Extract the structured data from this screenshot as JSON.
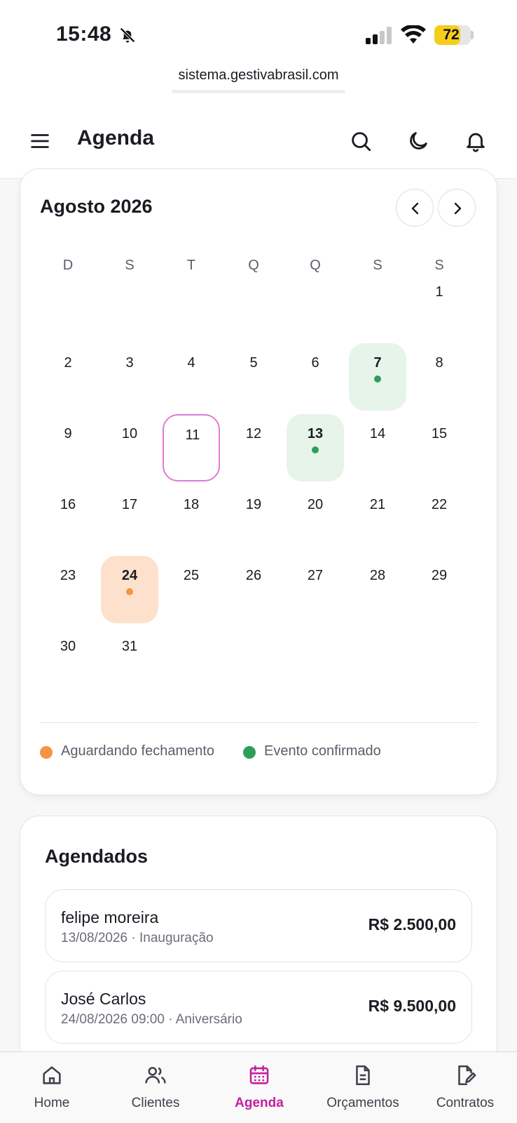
{
  "status_bar": {
    "time": "15:48",
    "battery": "72",
    "battery_level": 0.72
  },
  "browser": {
    "url": "sistema.gestivabrasil.com"
  },
  "header": {
    "title": "Agenda"
  },
  "calendar": {
    "month_label": "Agosto 2026",
    "weekdays": [
      "D",
      "S",
      "T",
      "Q",
      "Q",
      "S",
      "S"
    ],
    "days": [
      {
        "n": "1",
        "row": 0,
        "col": 6
      },
      {
        "n": "2",
        "row": 1,
        "col": 0
      },
      {
        "n": "3",
        "row": 1,
        "col": 1
      },
      {
        "n": "4",
        "row": 1,
        "col": 2
      },
      {
        "n": "5",
        "row": 1,
        "col": 3
      },
      {
        "n": "6",
        "row": 1,
        "col": 4
      },
      {
        "n": "7",
        "row": 1,
        "col": 5,
        "status": "confirmed"
      },
      {
        "n": "8",
        "row": 1,
        "col": 6
      },
      {
        "n": "9",
        "row": 2,
        "col": 0
      },
      {
        "n": "10",
        "row": 2,
        "col": 1
      },
      {
        "n": "11",
        "row": 2,
        "col": 2,
        "today": true
      },
      {
        "n": "12",
        "row": 2,
        "col": 3
      },
      {
        "n": "13",
        "row": 2,
        "col": 4,
        "status": "confirmed"
      },
      {
        "n": "14",
        "row": 2,
        "col": 5
      },
      {
        "n": "15",
        "row": 2,
        "col": 6
      },
      {
        "n": "16",
        "row": 3,
        "col": 0
      },
      {
        "n": "17",
        "row": 3,
        "col": 1
      },
      {
        "n": "18",
        "row": 3,
        "col": 2
      },
      {
        "n": "19",
        "row": 3,
        "col": 3
      },
      {
        "n": "20",
        "row": 3,
        "col": 4
      },
      {
        "n": "21",
        "row": 3,
        "col": 5
      },
      {
        "n": "22",
        "row": 3,
        "col": 6
      },
      {
        "n": "23",
        "row": 4,
        "col": 0
      },
      {
        "n": "24",
        "row": 4,
        "col": 1,
        "status": "pending"
      },
      {
        "n": "25",
        "row": 4,
        "col": 2
      },
      {
        "n": "26",
        "row": 4,
        "col": 3
      },
      {
        "n": "27",
        "row": 4,
        "col": 4
      },
      {
        "n": "28",
        "row": 4,
        "col": 5
      },
      {
        "n": "29",
        "row": 4,
        "col": 6
      },
      {
        "n": "30",
        "row": 5,
        "col": 0
      },
      {
        "n": "31",
        "row": 5,
        "col": 1
      }
    ],
    "legend": {
      "pending": "Aguardando fechamento",
      "confirmed": "Evento confirmado"
    }
  },
  "colors": {
    "accent": "#c51f9e",
    "today_border": "#e07ad6",
    "pending_dot": "#f59442",
    "pending_bg": "#fde1cc",
    "confirmed_dot": "#2f9e5a",
    "confirmed_bg": "#e7f4ea"
  },
  "agendados": {
    "title": "Agendados",
    "items": [
      {
        "name": "felipe moreira",
        "meta": "13/08/2026 · Inauguração",
        "value": "R$ 2.500,00"
      },
      {
        "name": "José Carlos",
        "meta": "24/08/2026 09:00 · Aniversário",
        "value": "R$ 9.500,00"
      }
    ]
  },
  "bottom_nav": [
    {
      "label": "Home",
      "icon": "home-icon"
    },
    {
      "label": "Clientes",
      "icon": "users-icon"
    },
    {
      "label": "Agenda",
      "icon": "calendar-icon",
      "active": true
    },
    {
      "label": "Orçamentos",
      "icon": "document-icon"
    },
    {
      "label": "Contratos",
      "icon": "contract-icon"
    }
  ]
}
